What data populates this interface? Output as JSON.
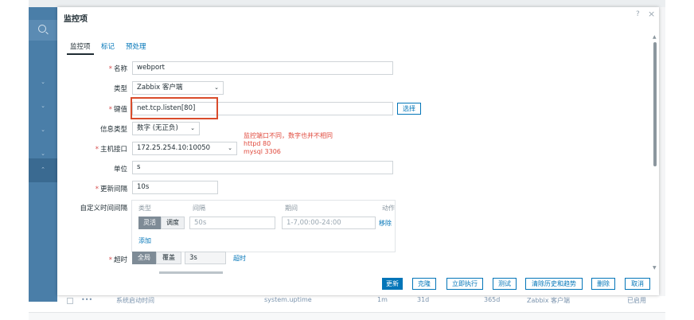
{
  "dialog": {
    "title": "监控项",
    "help": "?",
    "close": "×"
  },
  "tabs": [
    {
      "label": "监控项",
      "active": true
    },
    {
      "label": "标记",
      "active": false
    },
    {
      "label": "预处理",
      "active": false
    }
  ],
  "form": {
    "name": {
      "label": "名称",
      "required": "*",
      "value": "webport"
    },
    "type": {
      "label": "类型",
      "value": "Zabbix 客户端"
    },
    "key": {
      "label": "键值",
      "required": "*",
      "value": "net.tcp.listen[80]",
      "select_label": "选择"
    },
    "info_type": {
      "label": "信息类型",
      "value": "数字 (无正负)"
    },
    "host_interface": {
      "label": "主机接口",
      "required": "*",
      "value": "172.25.254.10:10050"
    },
    "units": {
      "label": "单位",
      "value": "s"
    },
    "update_interval": {
      "label": "更新间隔",
      "required": "*",
      "value": "10s"
    },
    "custom_intervals": {
      "label": "自定义时间间隔",
      "headers": {
        "type": "类型",
        "interval": "间隔",
        "period": "期间",
        "action": "动作"
      },
      "flexible_label": "灵活",
      "scheduling_label": "调度",
      "interval_placeholder": "50s",
      "period_placeholder": "1-7,00:00-24:00",
      "remove_label": "移除",
      "add_label": "添加"
    },
    "timeout": {
      "label": "超时",
      "required": "*",
      "global_label": "全局",
      "override_label": "覆盖",
      "value": "3s",
      "link_label": "超时"
    }
  },
  "annotation": {
    "line1": "监控端口不同，数字也并不相同",
    "line2": "httpd 80",
    "line3": "mysql 3306"
  },
  "footer_buttons": {
    "update": "更新",
    "clone": "克隆",
    "execute_now": "立即执行",
    "test": "测试",
    "clear_history": "清除历史和趋势",
    "delete": "删除",
    "cancel": "取消"
  },
  "background_row": {
    "col1": "•••",
    "col2": "系统启动时间",
    "col3": "system.uptime",
    "col4": "1m",
    "col5": "31d",
    "col6": "365d",
    "col7": "Zabbix 客户端",
    "col8": "已启用"
  },
  "colors": {
    "accent": "#0275b8",
    "sidebar": "#4a7ea8",
    "highlight": "#d94b2b",
    "annotation": "#e04a3d"
  }
}
